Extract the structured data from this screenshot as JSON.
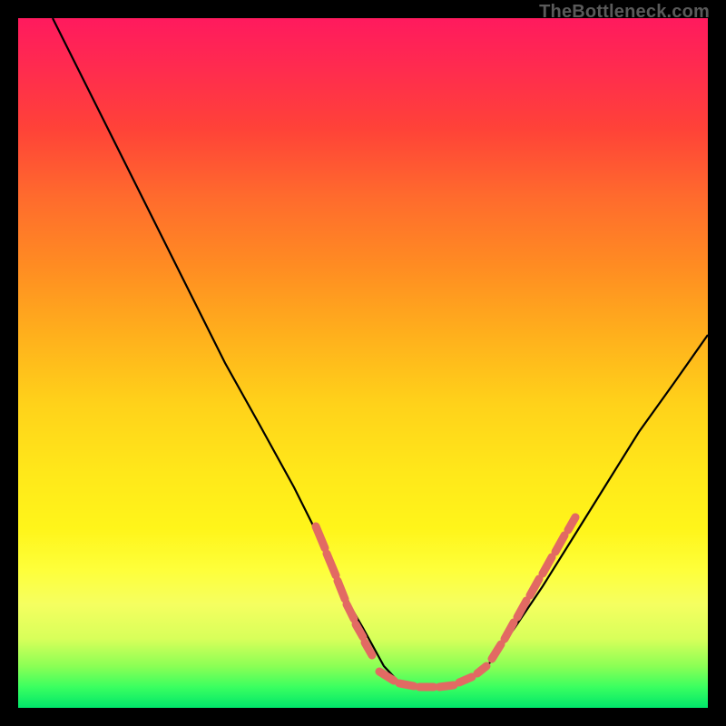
{
  "watermark": "TheBottleneck.com",
  "chart_data": {
    "type": "line",
    "title": "",
    "xlabel": "",
    "ylabel": "",
    "xlim": [
      0,
      100
    ],
    "ylim": [
      0,
      100
    ],
    "series": [
      {
        "name": "curve",
        "x": [
          5,
          10,
          15,
          20,
          25,
          30,
          35,
          40,
          45,
          48,
          50,
          53,
          55,
          58,
          60,
          63,
          65,
          68,
          72,
          76,
          80,
          85,
          90,
          95,
          100
        ],
        "values": [
          100,
          90,
          80,
          70,
          60,
          50,
          41,
          32,
          22,
          15,
          11,
          6,
          4,
          3,
          3,
          3,
          4,
          6,
          11,
          17,
          24,
          32,
          40,
          47,
          54
        ]
      }
    ],
    "markers": {
      "comment": "salmon dashed segments overlaid on steep curve flanks and valley floor",
      "left_cluster_y_range": [
        12,
        27
      ],
      "right_cluster_y_range": [
        10,
        28
      ],
      "floor_cluster_x_range": [
        50,
        68
      ]
    },
    "background": {
      "type": "vertical-gradient",
      "stops": [
        {
          "pos": 0.0,
          "color": "#ff1a5e"
        },
        {
          "pos": 0.5,
          "color": "#ffd21a"
        },
        {
          "pos": 0.8,
          "color": "#feff3a"
        },
        {
          "pos": 1.0,
          "color": "#00e66a"
        }
      ]
    }
  }
}
